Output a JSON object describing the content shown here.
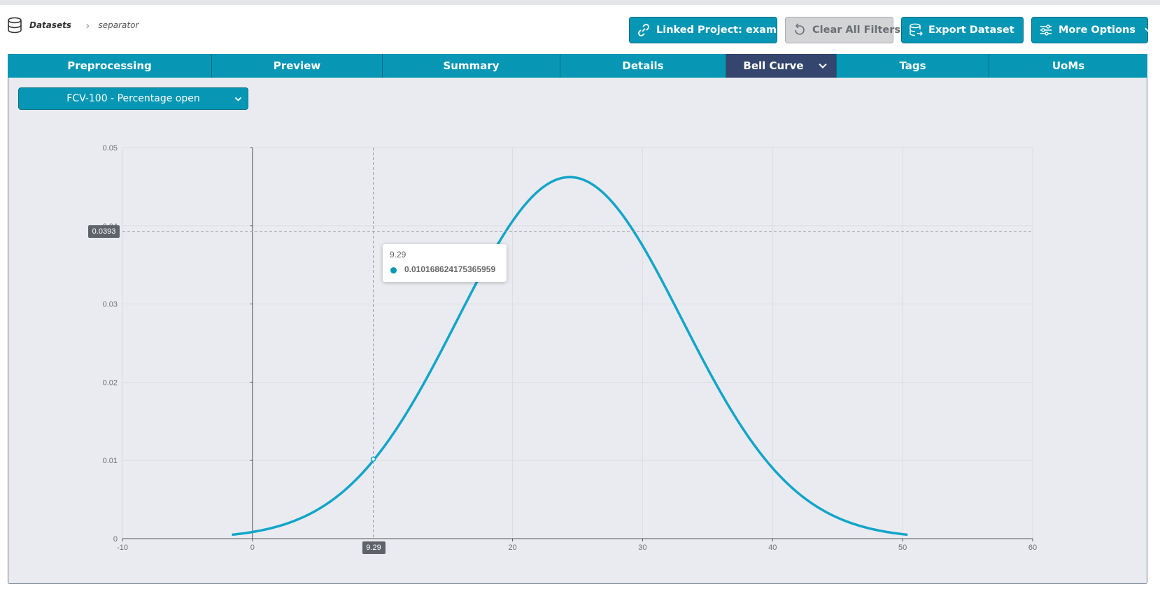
{
  "breadcrumb": {
    "root": "Datasets",
    "current": "separator"
  },
  "actions": {
    "linked_project": "Linked Project: example",
    "clear_filters": "Clear All Filters",
    "export": "Export Dataset",
    "more": "More Options"
  },
  "tabs": [
    {
      "label": "Preprocessing"
    },
    {
      "label": "Preview"
    },
    {
      "label": "Summary"
    },
    {
      "label": "Details"
    },
    {
      "label": "Bell Curve"
    },
    {
      "label": "Tags"
    },
    {
      "label": "UoMs"
    }
  ],
  "variable_select": {
    "value": "FCV-100 - Percentage open"
  },
  "tooltip": {
    "x": "9.29",
    "y": "0.010168624175365959"
  },
  "crosshair": {
    "x_label": "9.29",
    "y_label": "0.0393",
    "x": 9.29,
    "y": 0.0393
  },
  "colors": {
    "accent": "#0797b5",
    "active_tab": "#34466e",
    "curve": "#12a5c9",
    "panel": "#eaebf0"
  },
  "chart_data": {
    "type": "line",
    "title": "",
    "xlabel": "",
    "ylabel": "",
    "xlim": [
      -10,
      60
    ],
    "ylim": [
      0,
      0.05
    ],
    "x_ticks": [
      -10,
      0,
      20,
      30,
      40,
      50,
      60
    ],
    "y_ticks": [
      0,
      0.01,
      0.02,
      0.03,
      0.04,
      0.05
    ],
    "grid": true,
    "series": [
      {
        "distribution": "normal",
        "mean": 24.4,
        "std_dev": 8.63,
        "x_range": [
          -1.5,
          50.3
        ]
      }
    ],
    "highlighted_point": {
      "x": 9.29,
      "y": 0.010168624175365959
    }
  }
}
